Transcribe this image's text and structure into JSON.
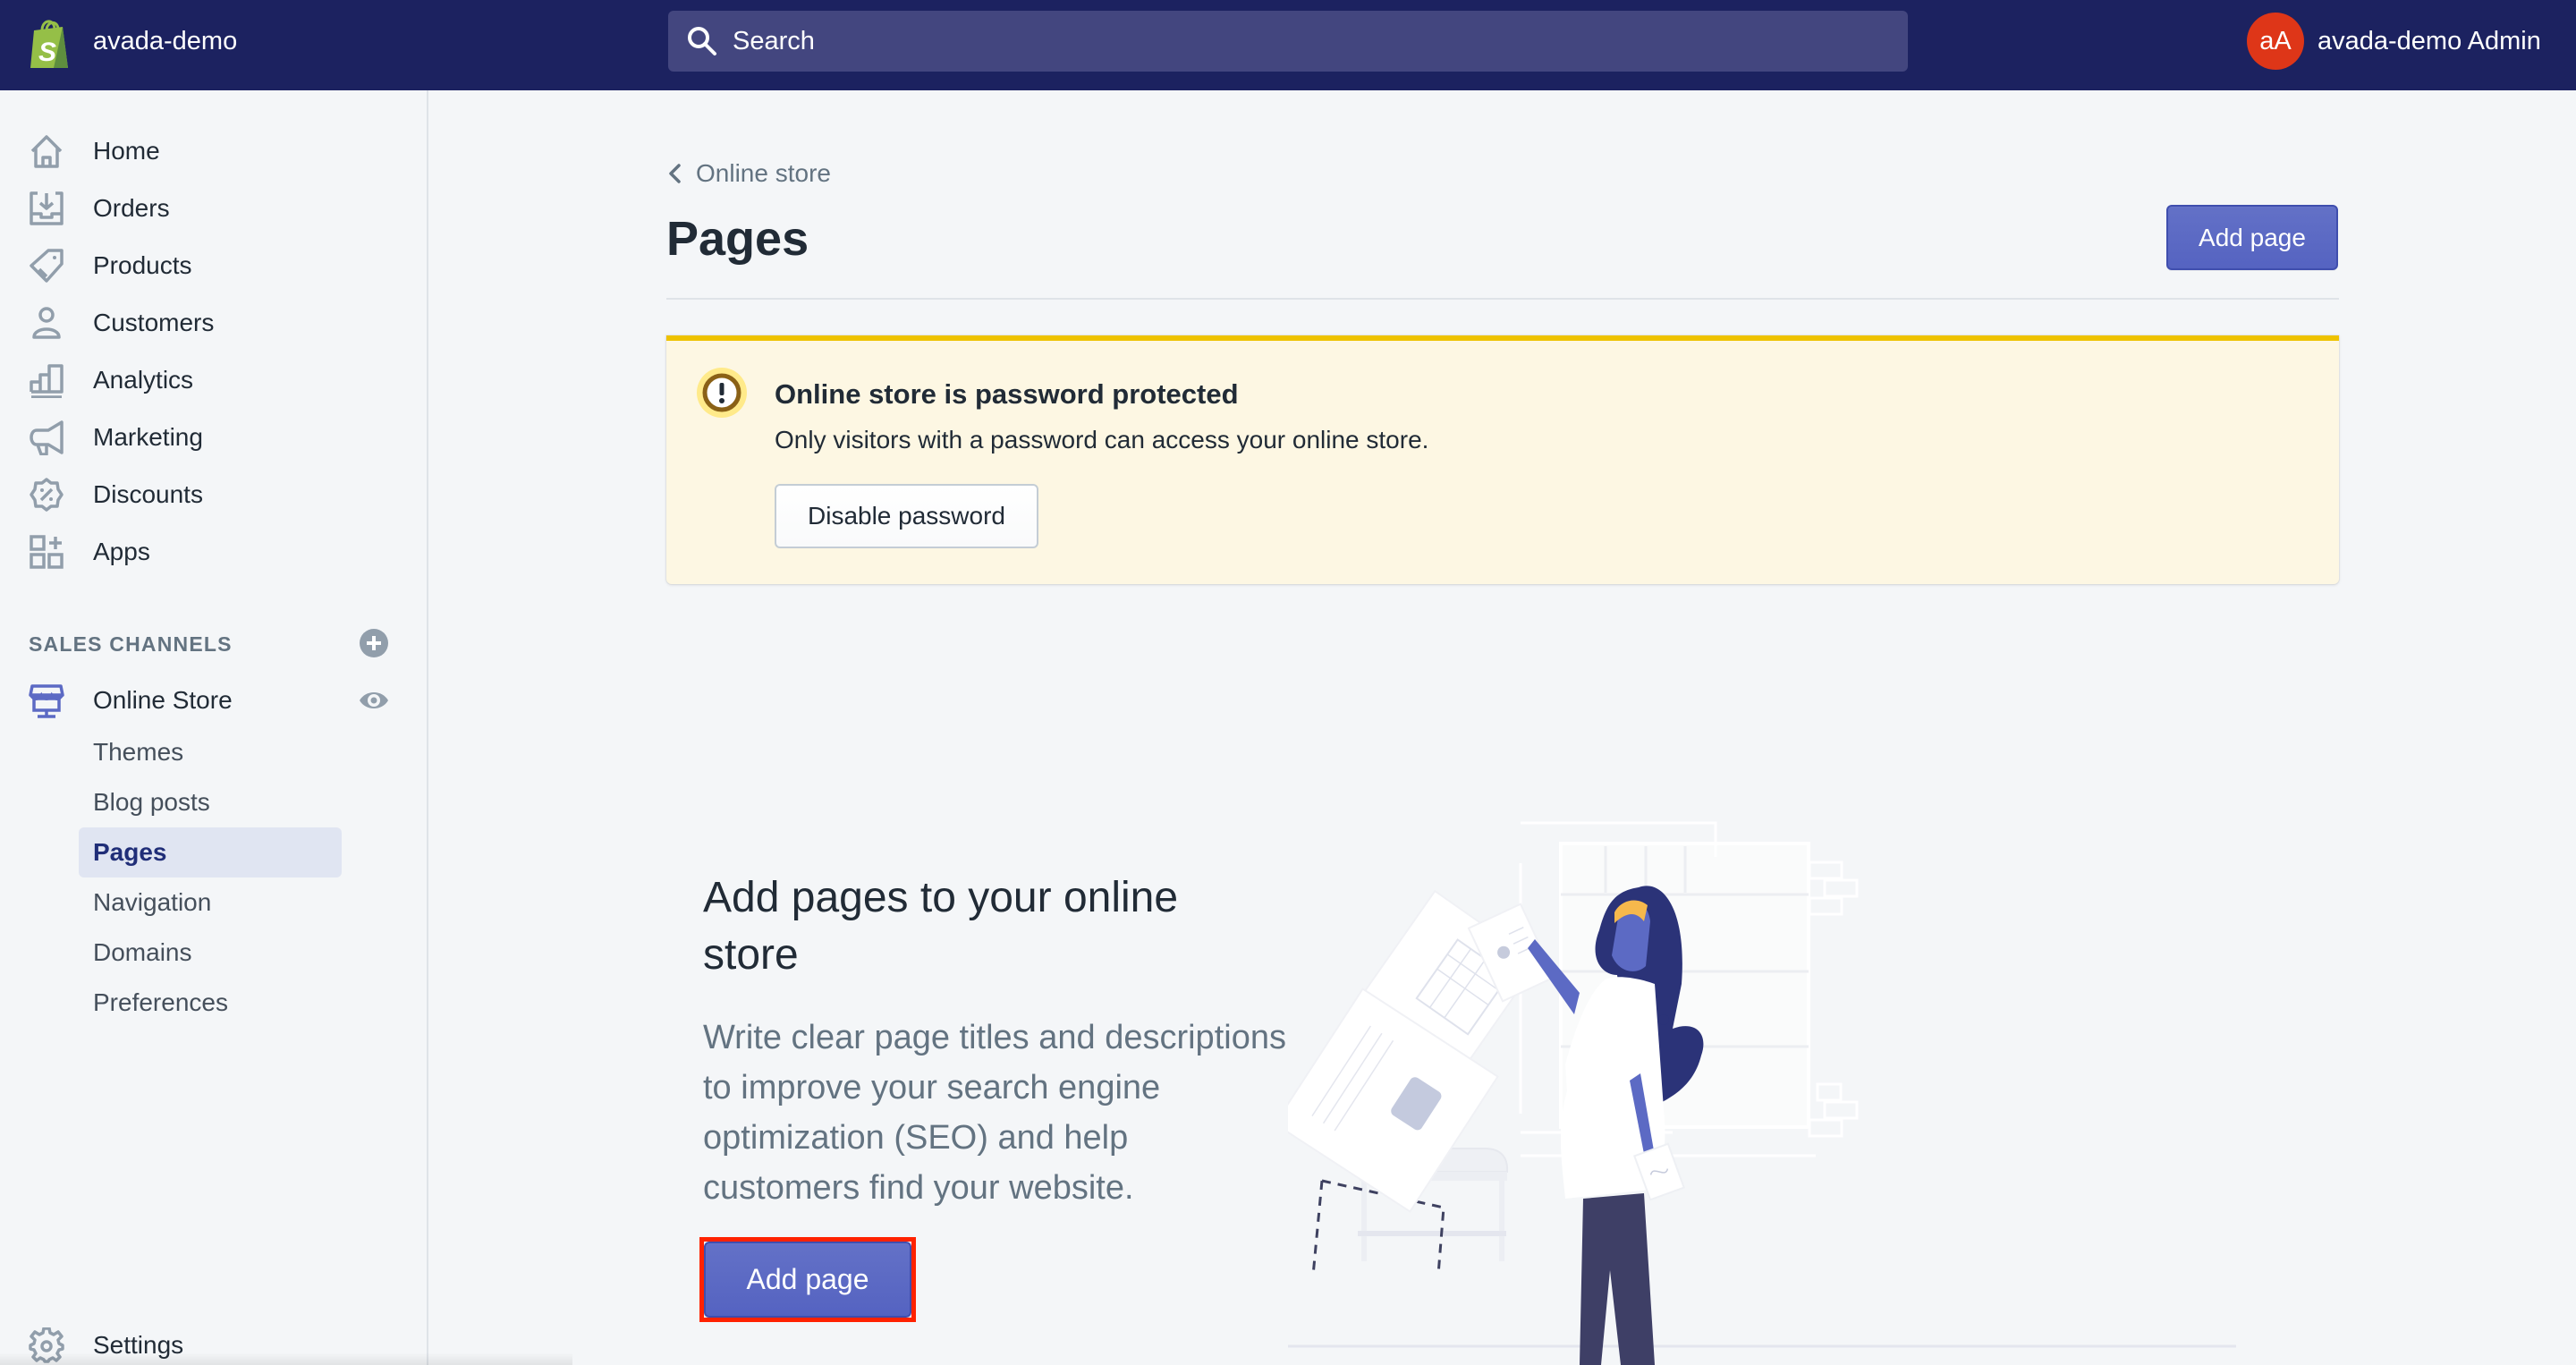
{
  "topbar": {
    "store_name": "avada-demo",
    "search_placeholder": "Search",
    "avatar_initials": "aA",
    "user_name": "avada-demo Admin"
  },
  "sidebar": {
    "items": [
      {
        "label": "Home",
        "icon": "home-icon"
      },
      {
        "label": "Orders",
        "icon": "orders-icon"
      },
      {
        "label": "Products",
        "icon": "tag-icon"
      },
      {
        "label": "Customers",
        "icon": "customer-icon"
      },
      {
        "label": "Analytics",
        "icon": "bar-chart-icon"
      },
      {
        "label": "Marketing",
        "icon": "megaphone-icon"
      },
      {
        "label": "Discounts",
        "icon": "discount-icon"
      },
      {
        "label": "Apps",
        "icon": "apps-icon"
      }
    ],
    "sales_channels_title": "SALES CHANNELS",
    "online_store": {
      "label": "Online Store",
      "sub_items": [
        {
          "label": "Themes",
          "active": false
        },
        {
          "label": "Blog posts",
          "active": false
        },
        {
          "label": "Pages",
          "active": true
        },
        {
          "label": "Navigation",
          "active": false
        },
        {
          "label": "Domains",
          "active": false
        },
        {
          "label": "Preferences",
          "active": false
        }
      ]
    },
    "settings_label": "Settings"
  },
  "main": {
    "breadcrumb": "Online store",
    "title": "Pages",
    "add_page_label": "Add page",
    "banner": {
      "title": "Online store is password protected",
      "text": "Only visitors with a password can access your online store.",
      "button_label": "Disable password"
    },
    "empty_state": {
      "title": "Add pages to your online store",
      "text": "Write clear page titles and descriptions to improve your search engine optimization (SEO) and help customers find your website.",
      "button_label": "Add page"
    }
  },
  "colors": {
    "topbar": "#1c2260",
    "primary": "#5c6ac4",
    "warning": "#eec200",
    "banner_bg": "#fdf7e3",
    "avatar": "#de3618",
    "highlight": "#ff2200"
  }
}
